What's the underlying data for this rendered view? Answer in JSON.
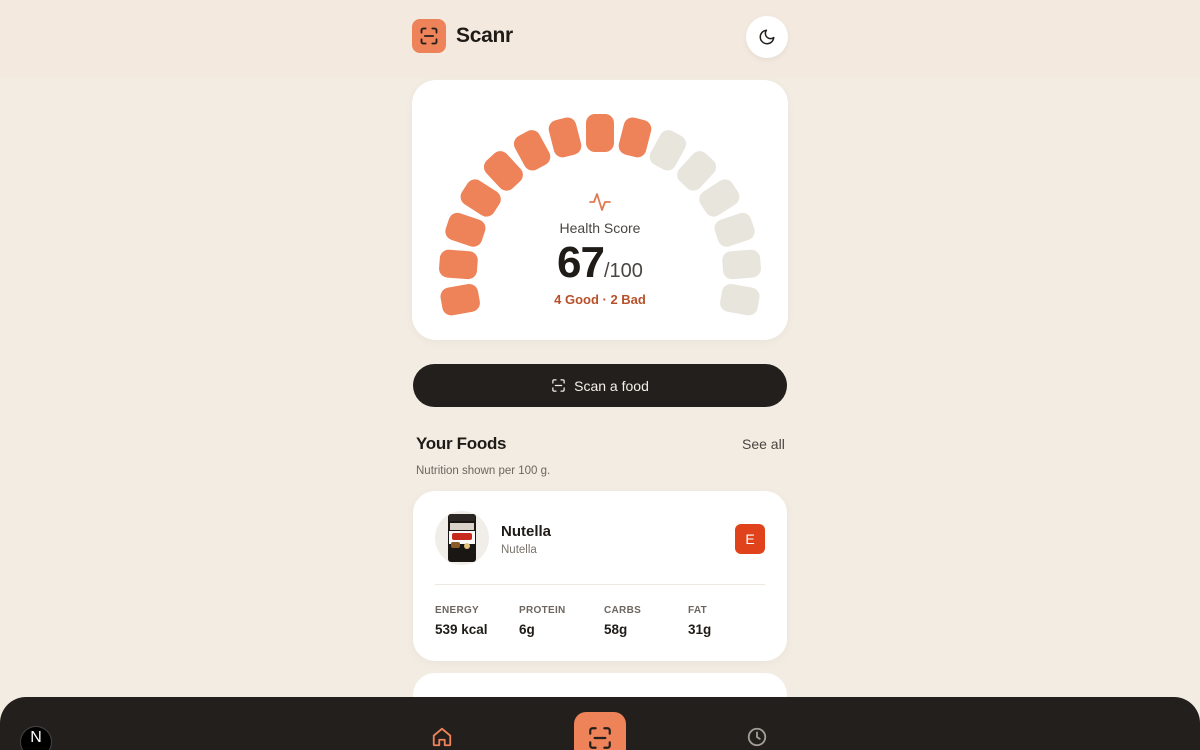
{
  "app": {
    "name": "Scanr"
  },
  "icons": {
    "logo": "scan-frame-icon",
    "theme": "moon-icon",
    "pulse": "activity-icon",
    "scan": "scan-frame-icon",
    "home": "home-icon",
    "history": "clock-icon"
  },
  "colors": {
    "accent": "#ee8258",
    "gauge_inactive": "#e8e5dd",
    "dark": "#231f1c",
    "grade_e": "#e0431c",
    "good_bad_text": "#b8502a"
  },
  "health": {
    "label": "Health Score",
    "score": "67",
    "max": "/100",
    "summary": "4 Good · 2 Bad",
    "gauge_segments_total": 15,
    "gauge_segments_filled": 9
  },
  "scan_button": {
    "label": "Scan a food"
  },
  "foods": {
    "title": "Your Foods",
    "see_all": "See all",
    "note": "Nutrition shown per 100 g.",
    "items": [
      {
        "name": "Nutella",
        "brand": "Nutella",
        "grade": "E",
        "nutrition": [
          {
            "label": "ENERGY",
            "value": "539 kcal"
          },
          {
            "label": "PROTEIN",
            "value": "6g"
          },
          {
            "label": "CARBS",
            "value": "58g"
          },
          {
            "label": "FAT",
            "value": "31g"
          }
        ]
      }
    ]
  },
  "dev_badge": {
    "letter": "N"
  }
}
